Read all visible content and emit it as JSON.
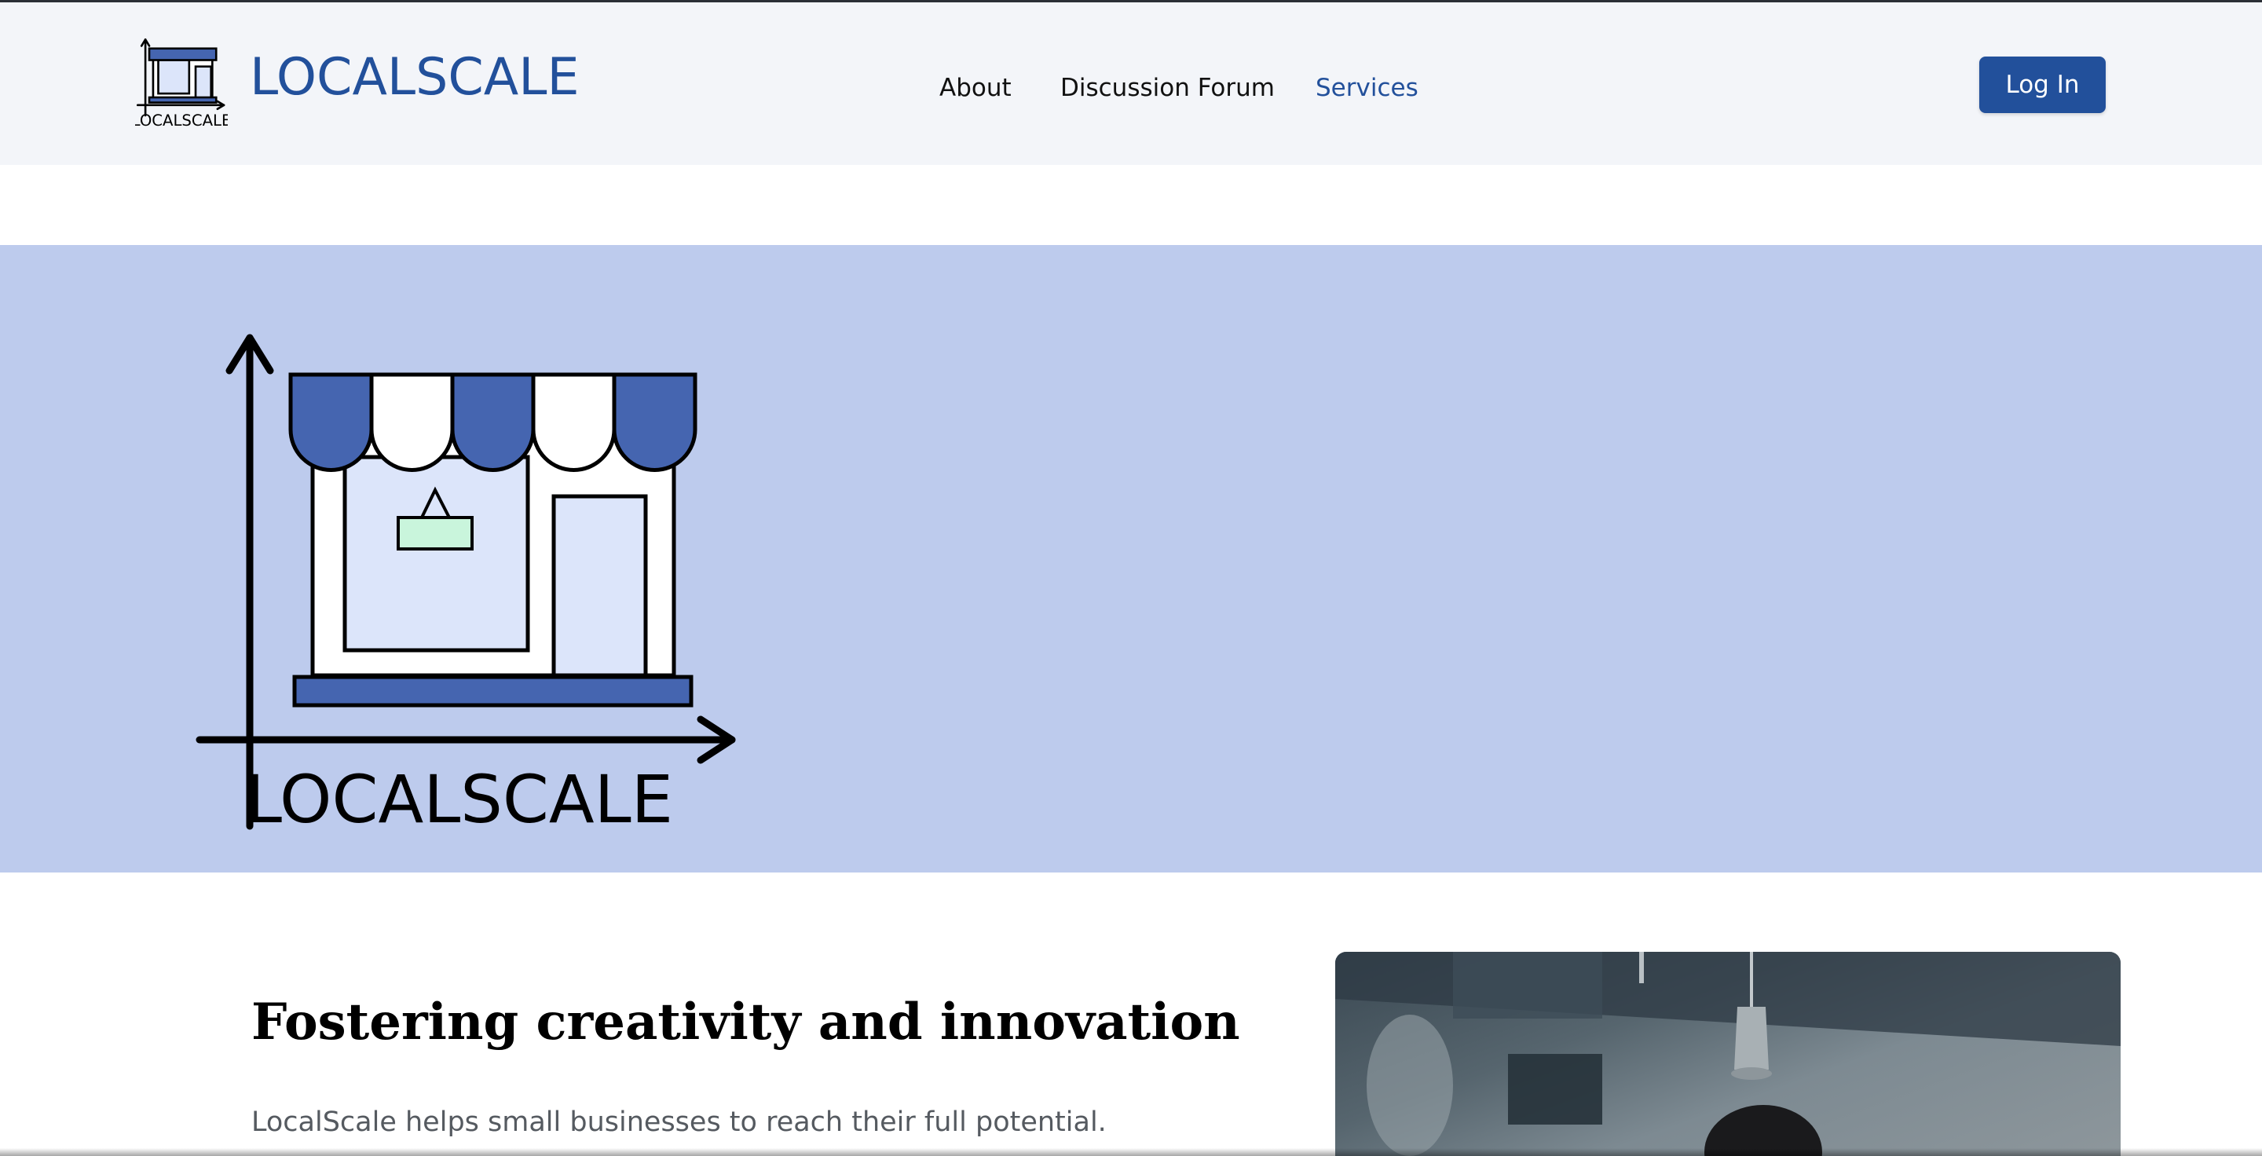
{
  "brand": {
    "name": "LOCALSCALE",
    "logo_caption": "LOCALSCALE",
    "logo_icon": "storefront-chart-logo"
  },
  "nav": {
    "items": [
      {
        "label": "About"
      },
      {
        "label": "Discussion Forum"
      },
      {
        "label": "Services",
        "active": true
      }
    ]
  },
  "header": {
    "login_label": "Log In"
  },
  "hero": {
    "logo_caption": "LOCALSCALE"
  },
  "content": {
    "headline": "Fostering creativity and innovation",
    "tagline": "LocalScale helps small businesses to reach their full potential."
  },
  "colors": {
    "brand_blue": "#22509b",
    "awning_blue": "#4565b0",
    "hero_bg": "#bdcbed",
    "header_bg": "#f3f5f9",
    "sign_green": "#c9f5dc"
  }
}
